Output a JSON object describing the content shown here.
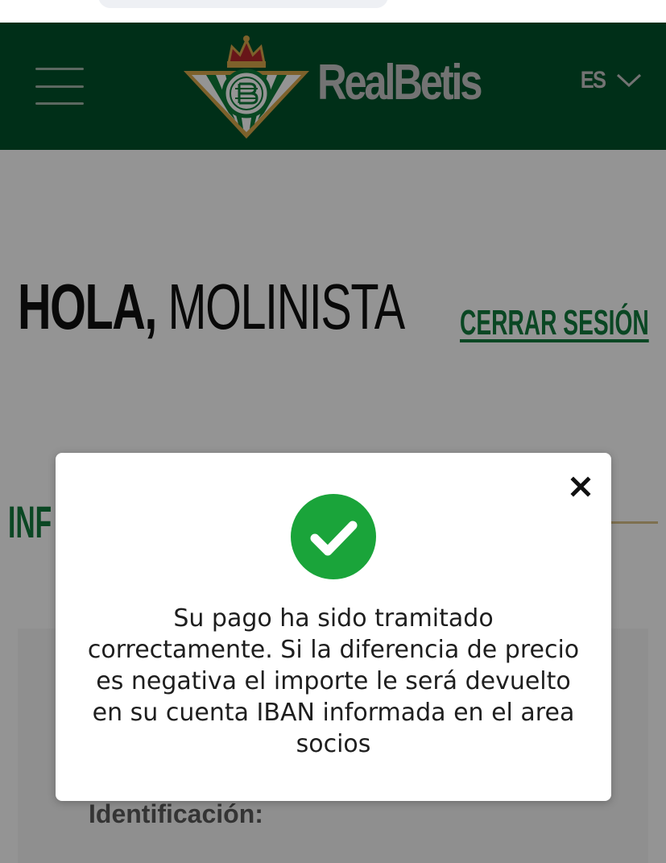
{
  "header": {
    "brand": "RealBetis",
    "language": "ES",
    "colors": {
      "background": "#00512a",
      "text": "#c6c6c6",
      "crest_gold": "#d8a84a",
      "crest_red": "#b3262b",
      "crest_green": "#0e7a3a"
    }
  },
  "page": {
    "greeting_bold": "HOLA,",
    "greeting_name": "MOLINISTA",
    "logout_label": "CERRAR SESIÓN",
    "section_title": "INF",
    "id_label": "Identificación:",
    "accent_color": "#127a3d"
  },
  "modal": {
    "close_icon": "close-icon",
    "status_icon": "check-circle-icon",
    "status_color": "#1aa43a",
    "message": "Su pago ha sido tramitado correctamente. Si la diferencia de precio es negativa el importe le será devuelto en su cuenta IBAN informada en el area socios"
  }
}
